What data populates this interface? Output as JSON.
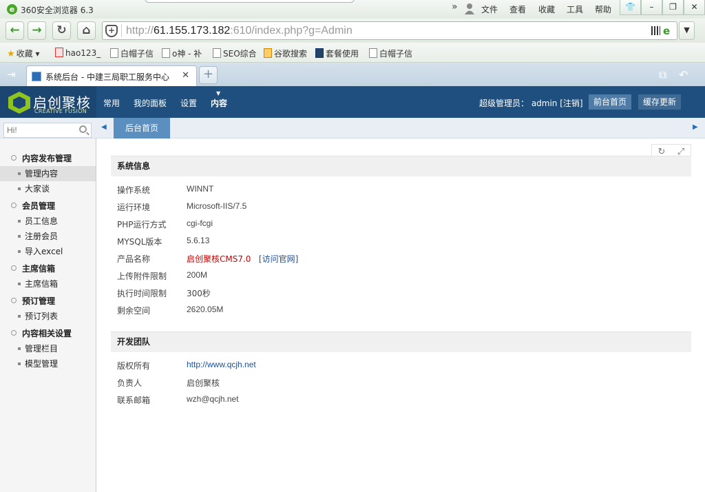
{
  "browser": {
    "title": "360安全浏览器 6.3",
    "menus": [
      "文件",
      "查看",
      "收藏",
      "工具",
      "帮助"
    ],
    "url_prefix": "http://",
    "url_host": "61.155.173.182",
    "url_rest": ":610/index.php?g=Admin",
    "favorites": [
      "收藏",
      "hao123_",
      "白帽子信",
      "o神 - 补",
      "SEO综合",
      "谷歌搜索",
      "套餐使用",
      "白帽子信"
    ],
    "tab_title": "系统后台 - 中建三局职工服务中心"
  },
  "cms": {
    "logo_name": "启创聚核",
    "logo_sub": "CREATIVE FUSION",
    "nav": [
      "常用",
      "我的面板",
      "设置",
      "内容"
    ],
    "admin_label": "超级管理员： admin [注销]",
    "btn_front": "前台首页",
    "btn_cache": "缓存更新",
    "search_placeholder": "Hi!",
    "subtab": "后台首页"
  },
  "sidebar": {
    "groups": [
      {
        "label": "内容发布管理",
        "items": [
          "管理内容",
          "大家谈"
        ]
      },
      {
        "label": "会员管理",
        "items": [
          "员工信息",
          "注册会员",
          "导入excel"
        ]
      },
      {
        "label": "主席信箱",
        "items": [
          "主席信箱"
        ]
      },
      {
        "label": "预订管理",
        "items": [
          "预订列表"
        ]
      },
      {
        "label": "内容相关设置",
        "items": [
          "管理栏目",
          "模型管理"
        ]
      }
    ]
  },
  "system_info": {
    "heading": "系统信息",
    "rows": [
      {
        "label": "操作系统",
        "value": "WINNT"
      },
      {
        "label": "运行环境",
        "value": "Microsoft-IIS/7.5"
      },
      {
        "label": "PHP运行方式",
        "value": "cgi-fcgi"
      },
      {
        "label": "MYSQL版本",
        "value": "5.6.13"
      },
      {
        "label": "产品名称",
        "value": "启创聚核CMS7.0",
        "extra": "[访问官网]"
      },
      {
        "label": "上传附件限制",
        "value": "200M"
      },
      {
        "label": "执行时间限制",
        "value": "300秒"
      },
      {
        "label": "剩余空间",
        "value": "2620.05M"
      }
    ]
  },
  "dev_team": {
    "heading": "开发团队",
    "rows": [
      {
        "label": "版权所有",
        "value": "http://www.qcjh.net"
      },
      {
        "label": "负责人",
        "value": "启创聚核"
      },
      {
        "label": "联系邮箱",
        "value": "wzh@qcjh.net"
      }
    ]
  }
}
